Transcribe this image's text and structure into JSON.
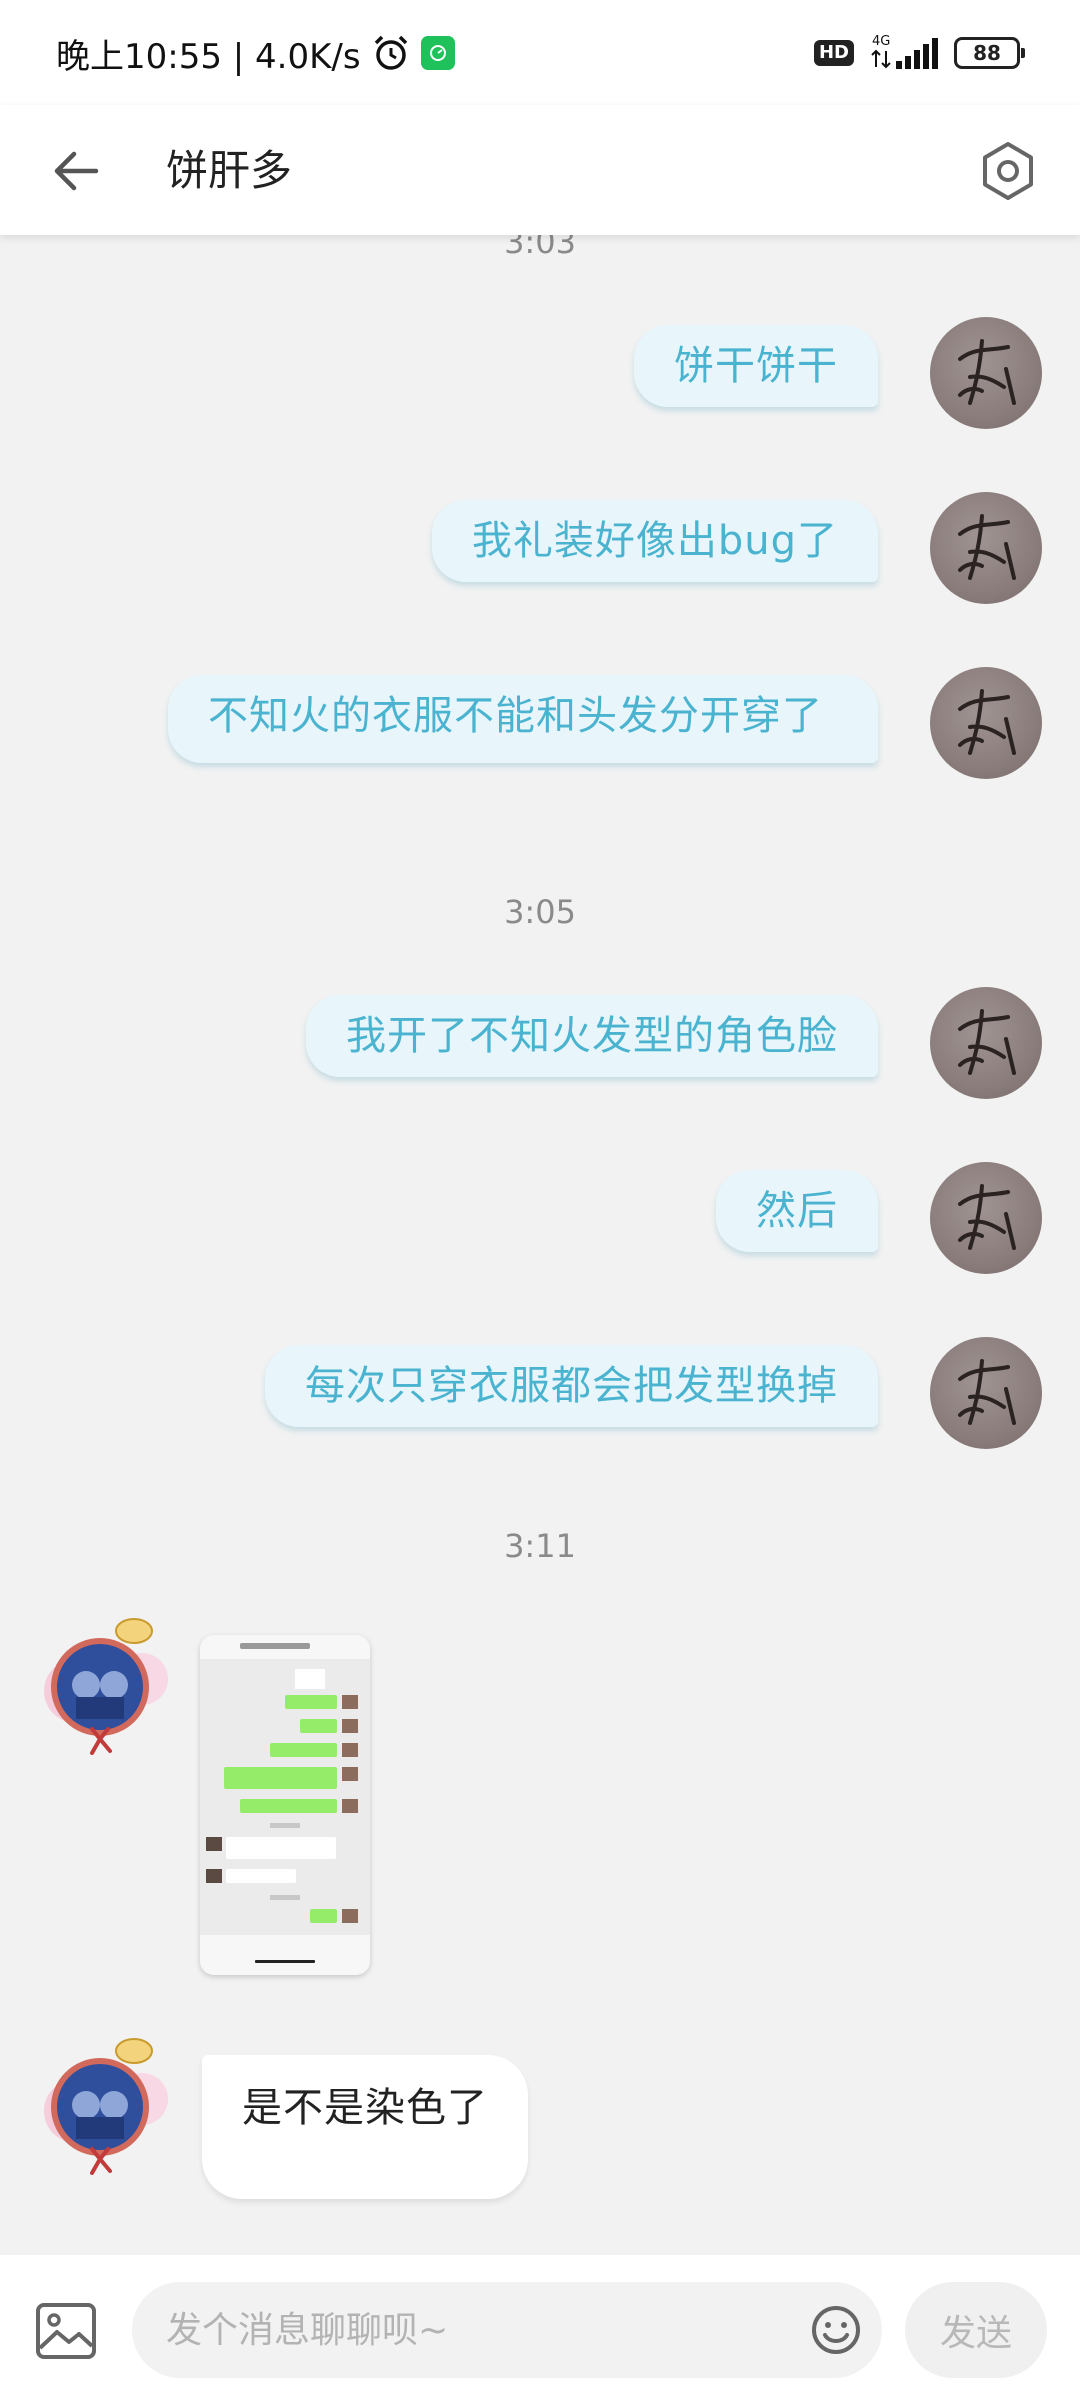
{
  "status_bar": {
    "time_and_speed": "晚上10:55 | 4.0K/s",
    "hd_label": "HD",
    "network_label": "4G",
    "battery_level": "88"
  },
  "header": {
    "title": "饼肝多",
    "back_icon": "arrow-left-icon",
    "settings_icon": "settings-hexagon-icon"
  },
  "messages": {
    "timestamps": [
      "3:03",
      "3:05",
      "3:11"
    ],
    "outgoing": [
      "饼干饼干",
      "我礼装好像出bug了",
      "不知火的衣服不能和头发分开穿了",
      "我开了不知火发型的角色脸",
      "然后",
      "每次只穿衣服都会把发型换掉"
    ],
    "incoming_text": "是不是染色了",
    "outgoing_bubble_color": "#e8f6fb",
    "outgoing_text_color": "#4ab3cf"
  },
  "composer": {
    "placeholder": "发个消息聊聊呗~",
    "send_label": "发送",
    "image_icon": "image-picker-icon",
    "emoji_icon": "emoji-smile-icon"
  }
}
